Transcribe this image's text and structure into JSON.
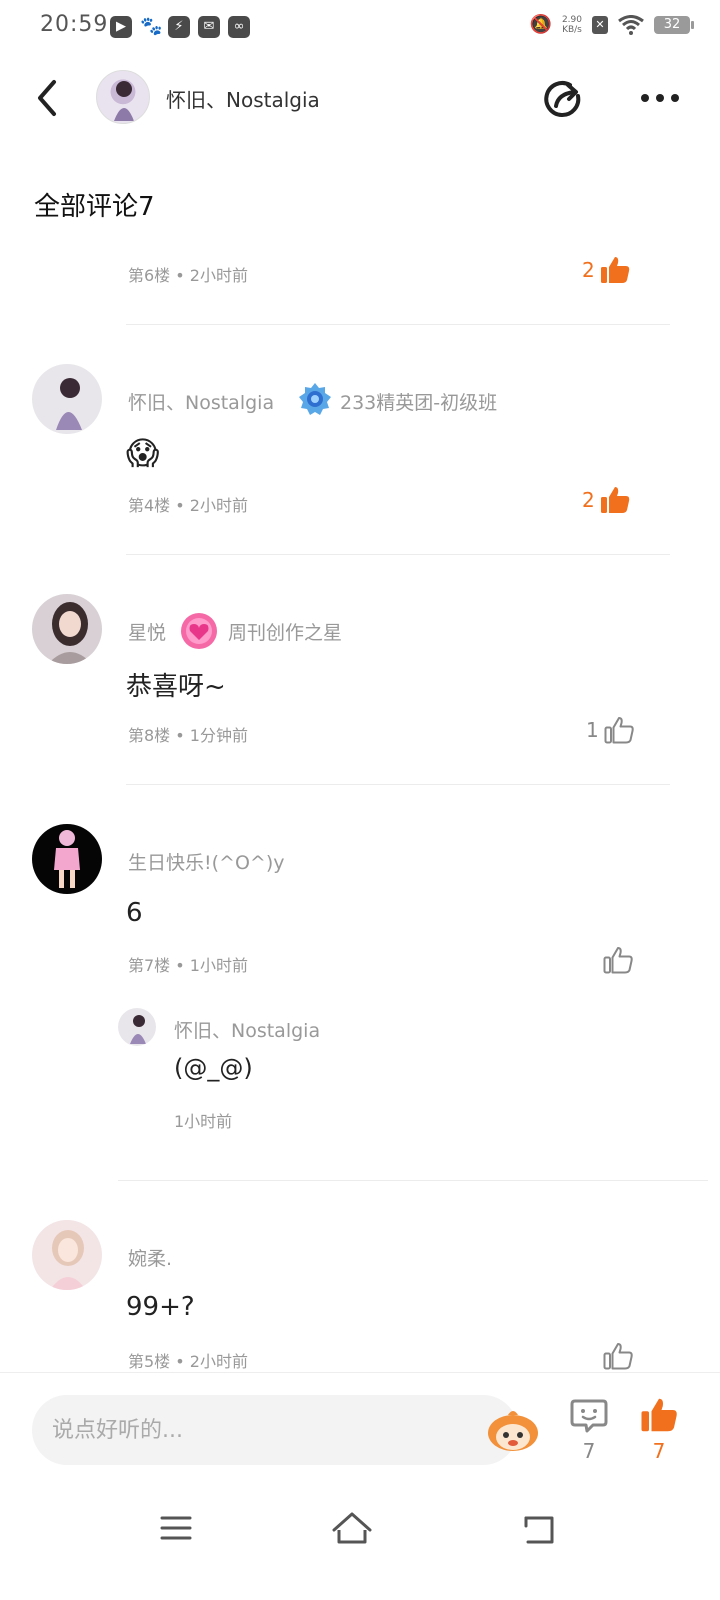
{
  "status_bar": {
    "time": "20:59",
    "net_speed_value": "2.90",
    "net_speed_unit": "KB/s",
    "battery": "32",
    "icons": [
      "play-icon",
      "paw-icon",
      "bolt-icon",
      "mail-icon",
      "link-icon",
      "mute-icon",
      "sim-icon",
      "wifi-icon",
      "battery-icon"
    ]
  },
  "header": {
    "title": "怀旧、Nostalgia"
  },
  "section_title": "全部评论7",
  "comments": [
    {
      "meta": "第6楼 • 2小时前",
      "likes": "2",
      "liked": true
    },
    {
      "user": "怀旧、Nostalgia",
      "badge": "233精英团-初级班",
      "content": "😱",
      "meta": "第4楼 • 2小时前",
      "likes": "2",
      "liked": true
    },
    {
      "user": "星悦",
      "badge": "周刊创作之星",
      "content": "恭喜呀~",
      "meta": "第8楼 • 1分钟前",
      "likes": "1",
      "liked": false
    },
    {
      "user": "生日快乐!(^O^)y",
      "content": "6",
      "meta": "第7楼 • 1小时前",
      "likes": "",
      "liked": false,
      "reply": {
        "user": "怀旧、Nostalgia",
        "content": "(@_@)",
        "meta": "1小时前"
      }
    },
    {
      "user": "婉柔.",
      "content": "99+?",
      "meta": "第5楼 • 2小时前",
      "likes": "",
      "liked": false
    }
  ],
  "bottom_bar": {
    "input_placeholder": "说点好听的...",
    "comment_count": "7",
    "like_count": "7"
  },
  "colors": {
    "accent": "#f0701e",
    "muted": "#999999"
  }
}
